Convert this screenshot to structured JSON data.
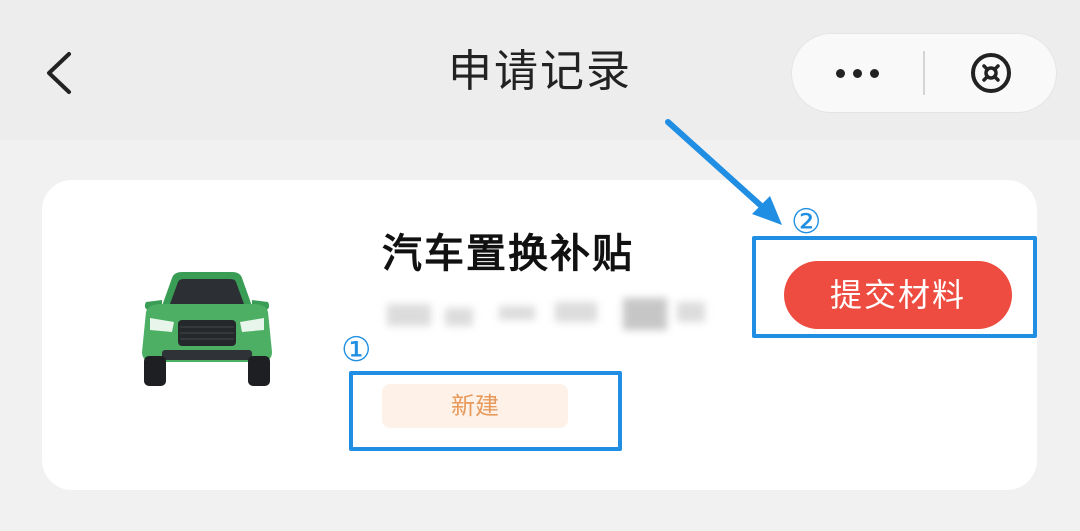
{
  "navbar": {
    "title": "申请记录",
    "back_icon": "chevron-left-icon",
    "more_icon": "more-dots-icon",
    "close_icon": "circle-close-icon"
  },
  "record": {
    "title": "汽车置换补贴",
    "status_label": "新建",
    "submit_label": "提交材料",
    "image_icon": "green-suv-car-icon"
  },
  "annotations": {
    "marker_1": "①",
    "marker_2": "②"
  },
  "colors": {
    "submit_button": "#ee4c40",
    "status_chip_bg": "#fdf1e8",
    "status_chip_text": "#e79a5b",
    "annotation": "#1f8ee3",
    "car_body": "#4caf64"
  }
}
